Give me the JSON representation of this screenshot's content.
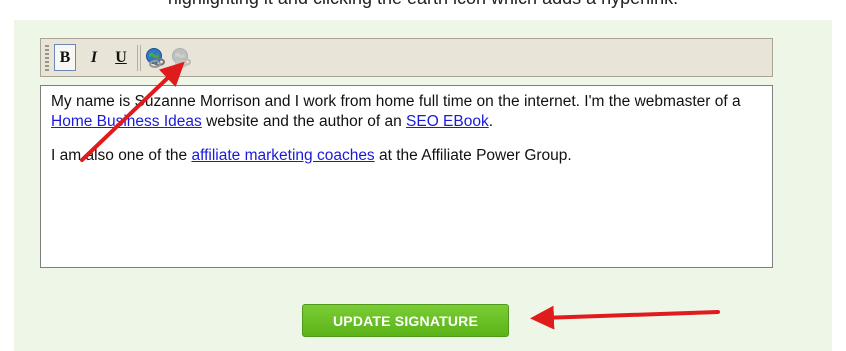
{
  "caption": "highlighting it and clicking the earth icon which adds a hyperlink.",
  "toolbar": {
    "bold": "B",
    "italic": "I",
    "underline": "U",
    "icons": [
      "insert-link-icon",
      "remove-link-icon"
    ]
  },
  "editor": {
    "p1": {
      "t1": "My name is Suzanne Morrison and I work from home full time on the internet. I'm the webmaster of a ",
      "link1": "Home Business Ideas",
      "t2": " website and the author of an ",
      "link2": "SEO EBook",
      "t3": "."
    },
    "p2": {
      "t1": "I am also one of the ",
      "link1": "affiliate marketing coaches",
      "t2": " at the Affiliate Power Group."
    }
  },
  "update_button": "UPDATE SIGNATURE",
  "colors": {
    "panel": "#eef6e8",
    "button": "#6cc22a",
    "link": "#1a1adb",
    "arrow": "#e01b1b"
  }
}
